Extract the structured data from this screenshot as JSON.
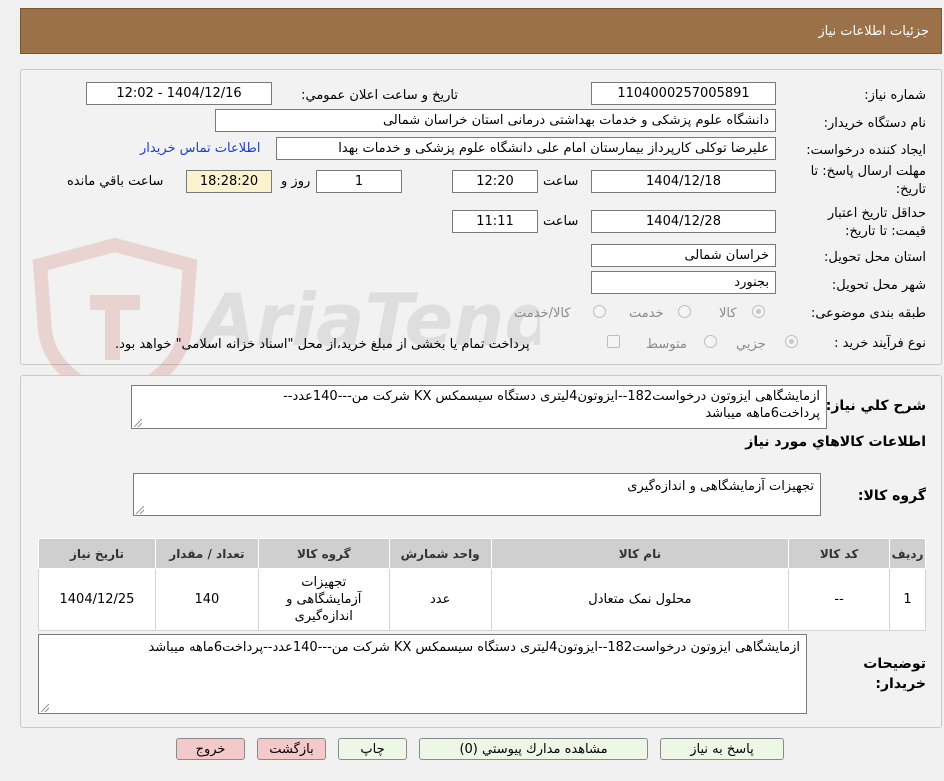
{
  "header": {
    "title": "جزئیات اطلاعات نیاز"
  },
  "form": {
    "need_number": {
      "label": "شماره نیاز:",
      "value": "1104000257005891"
    },
    "announce_datetime": {
      "label": "تاریخ و ساعت اعلان عمومي:",
      "value": "1404/12/16 - 12:02"
    },
    "buyer_org": {
      "label": "نام دستگاه خریدار:",
      "value": "دانشگاه علوم پزشکی و خدمات بهداشتی درمانی استان خراسان شمالی"
    },
    "requester": {
      "label": "ایجاد کننده درخواست:",
      "value": "علیرضا توکلی کارپرداز بیمارستان امام علی دانشگاه علوم پزشکی و خدمات بهدا",
      "contact_link": "اطلاعات تماس خریدار"
    },
    "deadline": {
      "label_line1": "مهلت ارسال پاسخ: تا",
      "label_line2": "تاریخ:",
      "date": "1404/12/18",
      "time_label": "ساعت",
      "time": "12:20",
      "days": "1",
      "days_label": "روز و",
      "remaining": "18:28:20",
      "remaining_label": "ساعت باقي مانده"
    },
    "price_validity": {
      "label_line1": "حداقل تاریخ اعتبار",
      "label_line2": "قیمت: تا تاریخ:",
      "date": "1404/12/28",
      "time_label": "ساعت",
      "time": "11:11"
    },
    "province": {
      "label": "استان محل تحویل:",
      "value": "خراسان شمالی"
    },
    "city": {
      "label": "شهر محل تحویل:",
      "value": "بجنورد"
    },
    "category": {
      "label": "طبقه بندی موضوعی:",
      "options": [
        "کالا",
        "خدمت",
        "کالا/خدمت"
      ],
      "selected": "کالا"
    },
    "process_type": {
      "label": "نوع فرآیند خرید :",
      "options": [
        "جزیي",
        "متوسط"
      ],
      "selected": "جزیي",
      "payment_note": "پرداخت تمام یا بخشی از مبلغ خرید،از محل \"اسناد خزانه اسلامی\" خواهد بود."
    }
  },
  "details": {
    "summary_label": "شرح کلي نیاز:",
    "summary_line1": "ازمایشگاهی ایزوتون درخواست182--ایزوتون4لیتری دستگاه سیسمکس KX شرکت من---140عدد--",
    "summary_line2": "پرداخت6ماهه میباشد",
    "goods_info_title": "اطلاعات کالاهاي مورد نیاز",
    "goods_group_label": "گروه کالا:",
    "goods_group_value": "تجهیزات آزمایشگاهی و اندازه‌گیری",
    "table": {
      "headers": [
        "ردیف",
        "کد کالا",
        "نام کالا",
        "واحد شمارش",
        "گروه کالا",
        "تعداد / مقدار",
        "تاریخ نیاز"
      ],
      "rows": [
        {
          "row": "1",
          "code": "--",
          "name": "محلول نمک متعادل",
          "unit": "عدد",
          "group_line1": "تجهیزات",
          "group_line2": "آزمایشگاهی و",
          "group_line3": "اندازه‌گیری",
          "qty": "140",
          "date": "1404/12/25"
        }
      ]
    },
    "buyer_notes_label_line1": "توضیحات",
    "buyer_notes_label_line2": "خریدار:",
    "buyer_notes": "ازمایشگاهی ایزوتون درخواست182--ایزوتون4لیتری دستگاه سیسمکس KX شرکت من---140عدد--پرداخت6ماهه میباشد"
  },
  "buttons": {
    "reply": "پاسخ به نیاز",
    "attachments": "مشاهده مدارك پیوستي (0)",
    "print": "چاپ",
    "back": "بازگشت",
    "exit": "خروج"
  },
  "watermark": {
    "text": "AriaTender.neT"
  }
}
